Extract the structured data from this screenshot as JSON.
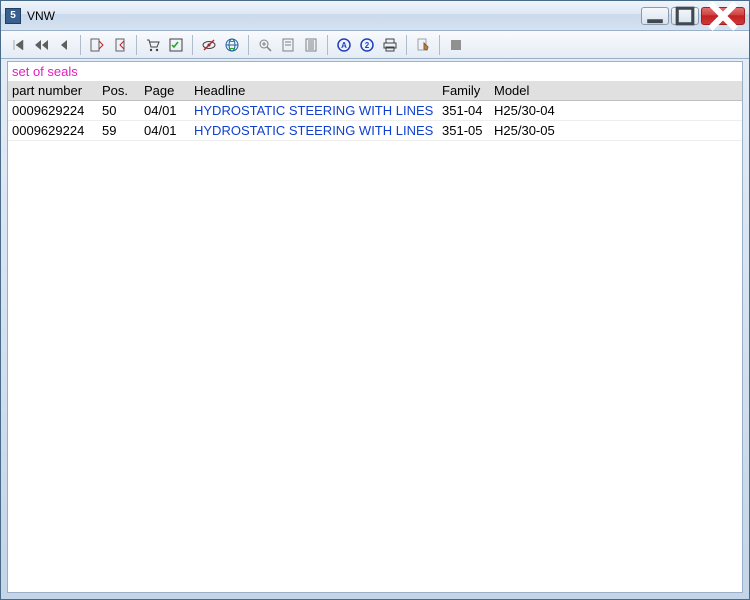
{
  "window": {
    "title": "VNW"
  },
  "section": {
    "title": "set of seals"
  },
  "columns": {
    "part_number": "part number",
    "pos": "Pos.",
    "page": "Page",
    "headline": "Headline",
    "family": "Family",
    "model": "Model"
  },
  "rows": [
    {
      "part_number": "0009629224",
      "pos": "50",
      "page": "04/01",
      "headline": "HYDROSTATIC STEERING WITH LINES",
      "family": "351-04",
      "model": "H25/30-04"
    },
    {
      "part_number": "0009629224",
      "pos": "59",
      "page": "04/01",
      "headline": "HYDROSTATIC STEERING WITH LINES",
      "family": "351-05",
      "model": "H25/30-05"
    }
  ],
  "toolbar_icons": [
    "nav-first-icon",
    "nav-rewind-icon",
    "nav-prev-icon",
    "bookmarks-open-icon",
    "bookmark-add-icon",
    "cart-icon",
    "checklist-icon",
    "eye-off-icon",
    "globe-icon",
    "zoom-icon",
    "page-icon",
    "page-dense-icon",
    "arrow-a-icon",
    "arrow-2-icon",
    "print-icon",
    "edit-icon",
    "stop-icon"
  ]
}
